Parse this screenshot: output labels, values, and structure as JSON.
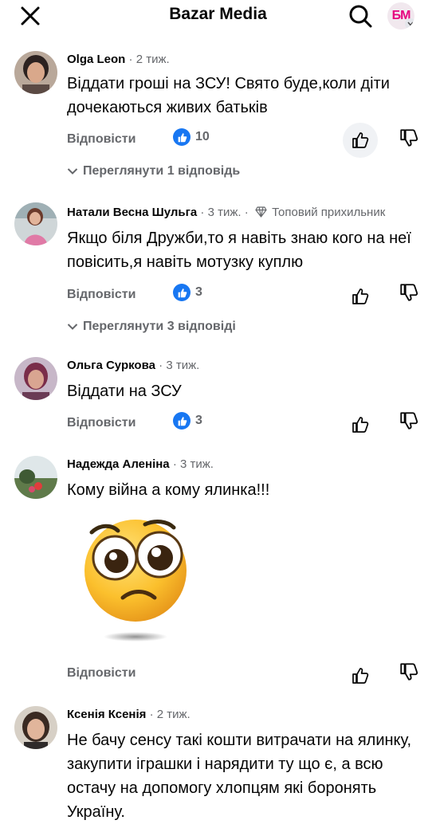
{
  "header": {
    "title": "Bazar Media",
    "page_logo_text": "БМ",
    "icons": [
      "close-icon",
      "search-icon",
      "chevron-down-icon"
    ]
  },
  "colors": {
    "like_blue": "#1877f2",
    "muted_text": "#65676b",
    "brand_pink": "#e6007e"
  },
  "labels": {
    "reply": "Відповісти"
  },
  "comments": [
    {
      "author": "Olga Leon",
      "time": "2 тиж.",
      "text": "Віддати гроші на ЗСУ! Свято буде,коли діти дочекаються живих батьків",
      "likes": "10",
      "view_replies": "Переглянути 1 відповідь"
    },
    {
      "author": "Натали Весна Шульга",
      "time": "3 тиж.",
      "badge": "Топовий прихильник",
      "text": "Якщо біля Дружби,то я навіть знаю кого на неї повісить,я навіть мотузку куплю",
      "likes": "3",
      "view_replies": "Переглянути 3 відповіді"
    },
    {
      "author": "Ольга Суркова",
      "time": "3 тиж.",
      "text": "Віддати на ЗСУ",
      "likes": "3"
    },
    {
      "author": "Надежда Аленіна",
      "time": "3 тиж.",
      "text": "Кому війна а кому ялинка!!!",
      "sticker": "pleading-face-sticker"
    },
    {
      "author": "Ксенія Ксенія",
      "time": "2 тиж.",
      "text": "Не бачу сенсу такі кошти витрачати на ялинку, закупити іграшки і нарядити ту що є, а всю остачу на допомогу хлопцям які боронять Україну."
    }
  ]
}
